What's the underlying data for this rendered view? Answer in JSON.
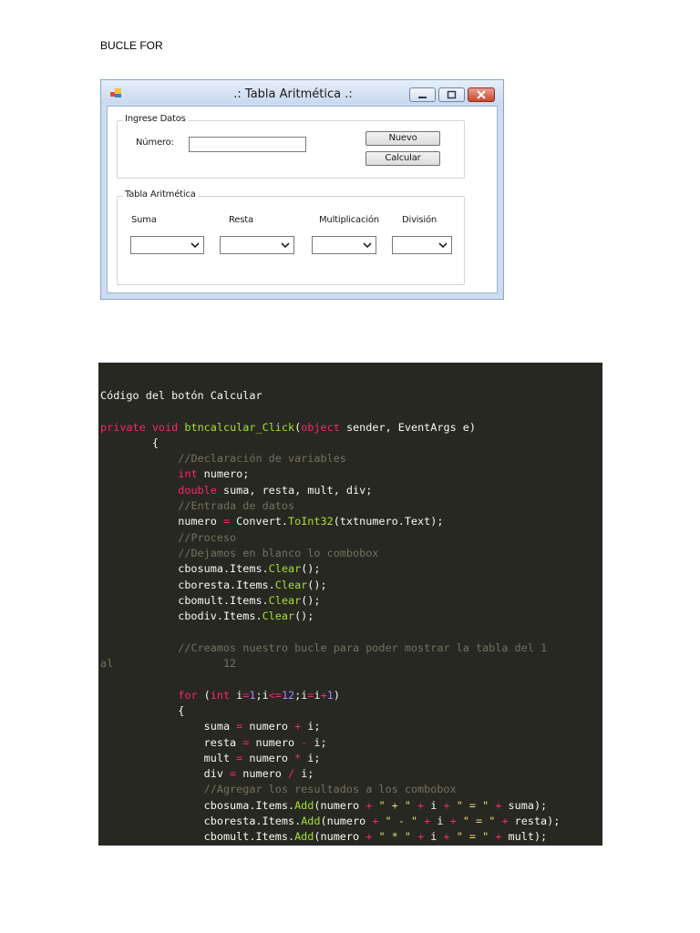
{
  "document": {
    "heading": "BUCLE FOR"
  },
  "form": {
    "window_title": ".: Tabla Aritmética .:",
    "group_input": {
      "label": "Ingrese Datos",
      "number_label": "Número:",
      "number_value": "",
      "new_button": "Nuevo",
      "calc_button": "Calcular"
    },
    "group_table": {
      "label": "Tabla Aritmética",
      "columns": [
        "Suma",
        "Resta",
        "Multiplicación",
        "División"
      ]
    }
  },
  "code": {
    "title": "Código del botón Calcular",
    "colors": {
      "background": "#272822",
      "keyword": "#f92672",
      "type": "#66d9ef",
      "function": "#a6e22e",
      "comment": "#75715e",
      "number": "#ae81ff",
      "string": "#e6db74"
    }
  }
}
